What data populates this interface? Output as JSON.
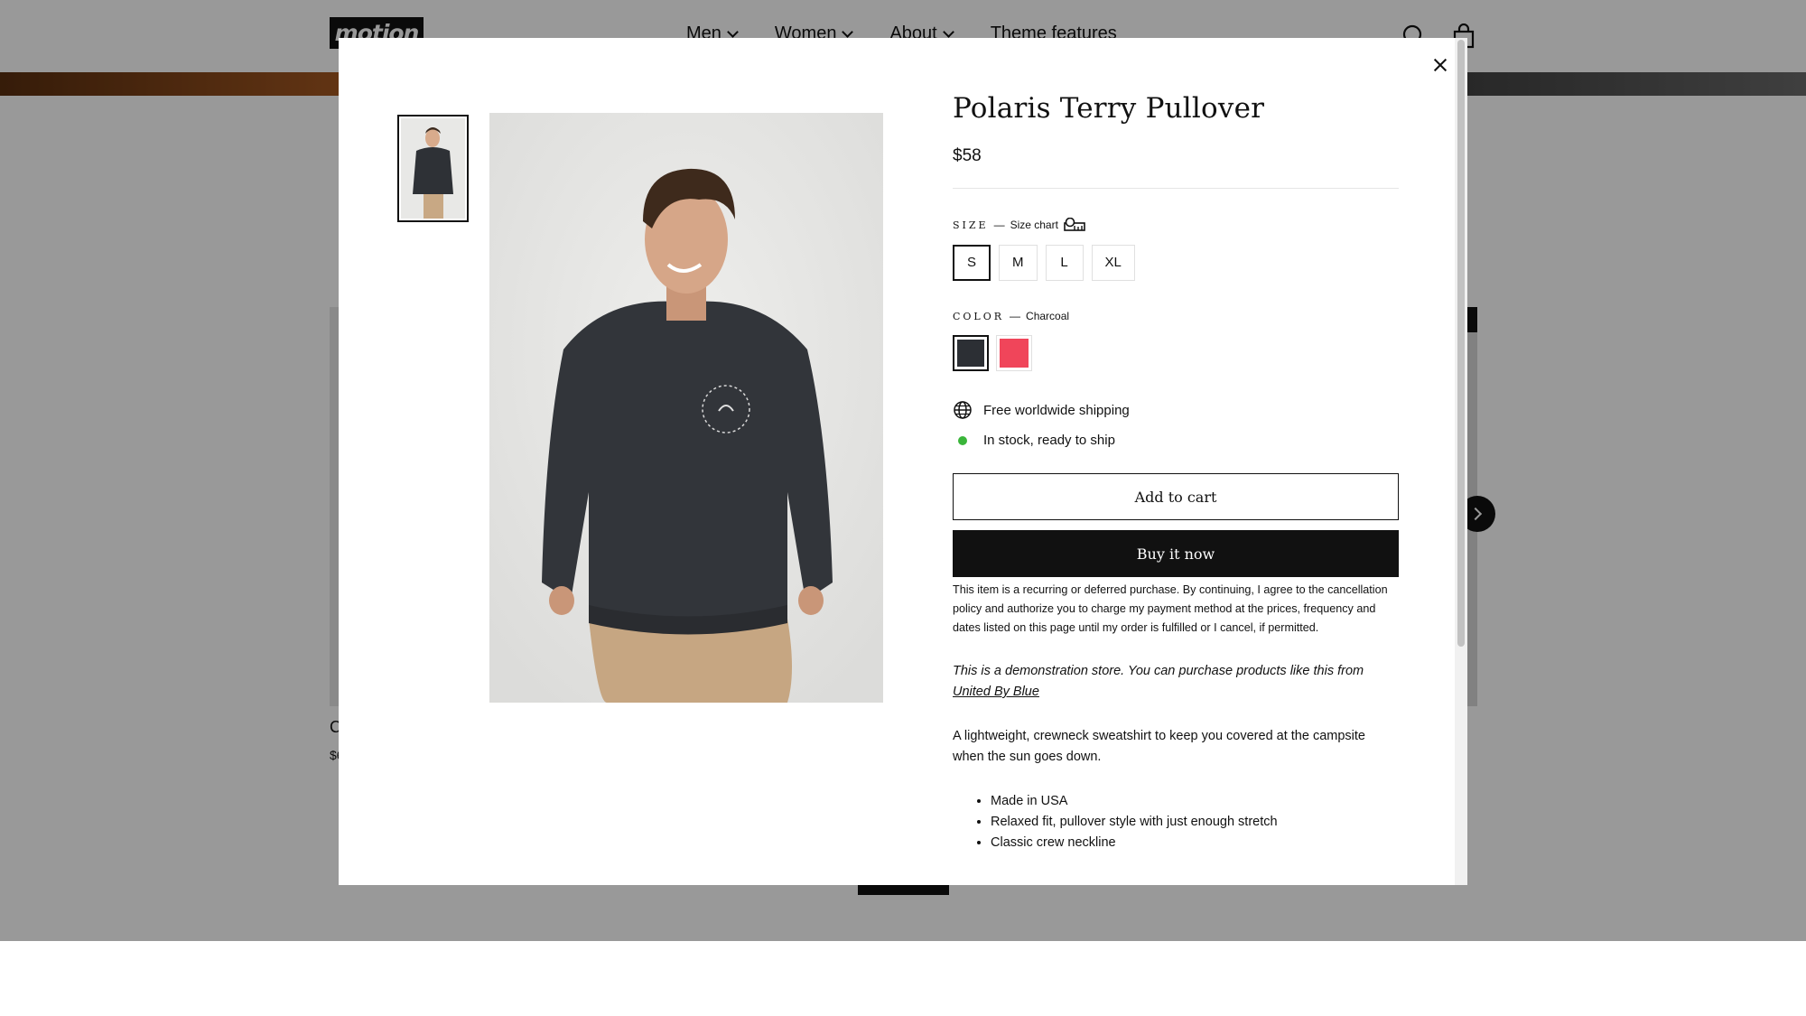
{
  "header": {
    "logo": "motion",
    "nav": [
      "Men",
      "Women",
      "About",
      "Theme features"
    ],
    "search_icon": "search-icon",
    "cart_icon": "bag-icon"
  },
  "background": {
    "card_title_fragment": "C",
    "card_price_fragment": "$6"
  },
  "product": {
    "title": "Polaris Terry Pullover",
    "price": "$58",
    "size_label": "SIZE",
    "size_chart": "Size chart",
    "sizes": [
      "S",
      "M",
      "L",
      "XL"
    ],
    "selected_size": "S",
    "color_label": "COLOR",
    "selected_color": "Charcoal",
    "swatch_colors": [
      "#2c2f34",
      "#f0455a"
    ],
    "shipping": "Free worldwide shipping",
    "stock": "In stock, ready to ship",
    "add_to_cart": "Add to cart",
    "buy_now": "Buy it now",
    "recurring_notice": "This item is a recurring or deferred purchase. By continuing, I agree to the cancellation policy and authorize you to charge my payment method at the prices, frequency and dates listed on this page until my order is fulfilled or I cancel, if permitted.",
    "demo_text": "This is a demonstration store. You can purchase products like this from",
    "demo_link": "United By Blue",
    "description": "A lightweight, crewneck sweatshirt to keep you covered at the campsite when the sun goes down.",
    "bullets": [
      "Made in USA",
      "Relaxed fit, pullover style with just enough stretch",
      "Classic crew neckline"
    ]
  }
}
